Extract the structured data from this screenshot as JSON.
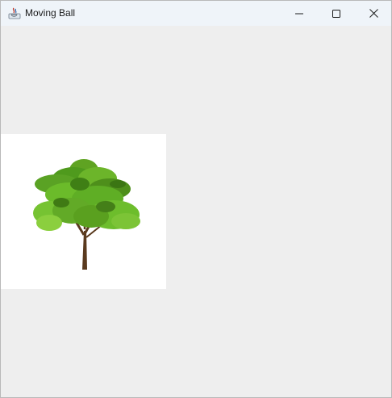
{
  "window": {
    "title": "Moving Ball",
    "app_icon": "java-cup-icon",
    "controls": [
      "minimize-icon",
      "maximize-icon",
      "close-icon"
    ]
  },
  "canvas": {
    "background_color": "#eeeeee",
    "sprite": "tree-icon",
    "sprite_background": "#ffffff"
  }
}
